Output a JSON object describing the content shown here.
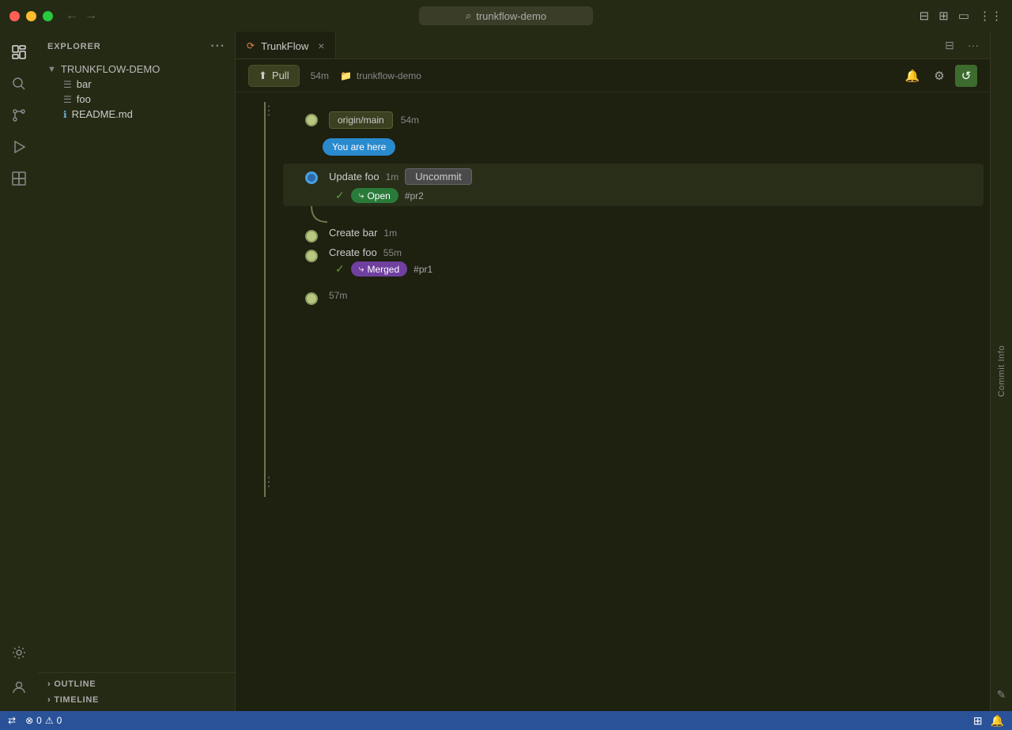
{
  "titlebar": {
    "back_arrow": "←",
    "forward_arrow": "→",
    "search_placeholder": "trunkflow-demo",
    "search_icon": "⌕"
  },
  "activity": {
    "icons": [
      "⬜",
      "🔍",
      "⑂",
      "▷",
      "⬡",
      "⚙",
      "👤"
    ]
  },
  "sidebar": {
    "header": "Explorer",
    "more_icon": "···",
    "folder_name": "TRUNKFLOW-DEMO",
    "folder_arrow": "▼",
    "files": [
      {
        "name": "bar",
        "icon": "☰"
      },
      {
        "name": "foo",
        "icon": "☰"
      },
      {
        "name": "README.md",
        "icon": "ℹ"
      }
    ],
    "bottom_sections": [
      {
        "label": "OUTLINE",
        "arrow": "›"
      },
      {
        "label": "TIMELINE",
        "arrow": "›"
      }
    ]
  },
  "tab": {
    "icon": "⟳",
    "label": "TrunkFlow",
    "close": "×"
  },
  "toolbar": {
    "pull_label": "Pull",
    "pull_icon": "⬆",
    "time": "54m",
    "folder_icon": "📁",
    "folder_label": "trunkflow-demo",
    "bell_icon": "🔔",
    "settings_icon": "⚙",
    "refresh_icon": "↺"
  },
  "commits": {
    "origin_badge": "origin/main",
    "origin_time": "54m",
    "you_are_here": "You are here",
    "entries": [
      {
        "id": "c1",
        "title": "Update foo",
        "time": "1m",
        "action": "Uncommit",
        "has_action": true,
        "sub": {
          "has_sub": true,
          "badge_type": "open",
          "badge_label": "Open",
          "badge_icon": "⤷",
          "pr": "#pr2"
        },
        "highlighted": true,
        "dot_type": "blue"
      },
      {
        "id": "c2",
        "title": "Create bar",
        "time": "1m",
        "has_action": false,
        "sub": {
          "has_sub": false
        },
        "highlighted": false,
        "dot_type": "normal"
      },
      {
        "id": "c3",
        "title": "Create foo",
        "time": "55m",
        "has_action": false,
        "sub": {
          "has_sub": true,
          "badge_type": "merged",
          "badge_label": "Merged",
          "badge_icon": "⤷",
          "pr": "#pr1"
        },
        "highlighted": false,
        "dot_type": "normal"
      }
    ],
    "bottom_time": "57m"
  },
  "right_panel": {
    "label": "Commit Info",
    "edit_icon": "✎"
  },
  "statusbar": {
    "remote_icon": "⇄",
    "error_count": "0",
    "warning_count": "0",
    "bell_icon": "🔔",
    "layout_icon": "⊞"
  }
}
